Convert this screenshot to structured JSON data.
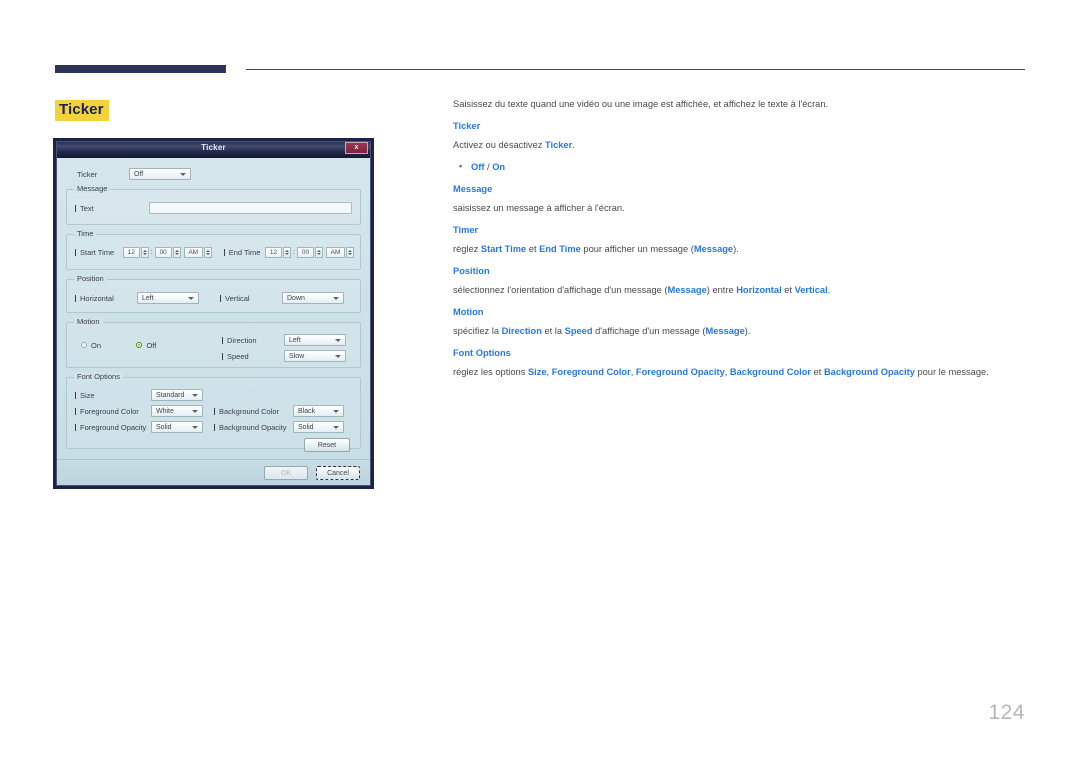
{
  "page": {
    "section_title": "Ticker",
    "page_number": "124",
    "accent_link": "#2878e0",
    "highlight": "#f4d23c",
    "rule_color": "#2e3358"
  },
  "dialog": {
    "title": "Ticker",
    "close_label": "x",
    "ticker": {
      "label": "Ticker",
      "value": "Off"
    },
    "message": {
      "legend": "Message",
      "text_label": "Text",
      "text_value": ""
    },
    "time": {
      "legend": "Time",
      "start_label": "Start Time",
      "start_hour": "12",
      "start_minute": "00",
      "start_meridiem": "AM",
      "end_label": "End Time",
      "end_hour": "12",
      "end_minute": "00",
      "end_meridiem": "AM",
      "colon": ":"
    },
    "position": {
      "legend": "Position",
      "horizontal_label": "Horizontal",
      "horizontal_value": "Left",
      "vertical_label": "Vertical",
      "vertical_value": "Down"
    },
    "motion": {
      "legend": "Motion",
      "on_label": "On",
      "off_label": "Off",
      "selected": "Off",
      "direction_label": "Direction",
      "direction_value": "Left",
      "speed_label": "Speed",
      "speed_value": "Slow"
    },
    "font_options": {
      "legend": "Font Options",
      "size_label": "Size",
      "size_value": "Standard",
      "foreground_color_label": "Foreground Color",
      "foreground_color_value": "White",
      "background_color_label": "Background Color",
      "background_color_value": "Black",
      "foreground_opacity_label": "Foreground Opacity",
      "foreground_opacity_value": "Solid",
      "background_opacity_label": "Background Opacity",
      "background_opacity_value": "Solid",
      "reset_label": "Reset"
    },
    "footer": {
      "ok_label": "OK",
      "cancel_label": "Cancel"
    }
  },
  "doc": {
    "intro": "Saisissez du texte quand une vidéo ou une image est affichée, et affichez le texte à l'écran.",
    "ticker_heading": "Ticker",
    "ticker_line_pre": "Activez ou désactivez ",
    "ticker_line_key": "Ticker",
    "ticker_line_post": ".",
    "bullet_off": "Off",
    "bullet_sep": " / ",
    "bullet_on": "On",
    "message_heading": "Message",
    "message_line": "saisissez un message à afficher à l'écran.",
    "timer_heading": "Timer",
    "timer_line_a": "réglez ",
    "timer_key_start": "Start Time",
    "timer_line_b": " et ",
    "timer_key_end": "End Time",
    "timer_line_c": " pour afficher un message (",
    "timer_key_msg": "Message",
    "timer_line_d": ").",
    "position_heading": "Position",
    "position_line_a": "sélectionnez l'orientation d'affichage d'un message (",
    "position_key_msg": "Message",
    "position_line_b": ") entre ",
    "position_key_h": "Horizontal",
    "position_line_c": " et ",
    "position_key_v": "Vertical",
    "position_line_d": ".",
    "motion_heading": "Motion",
    "motion_line_a": "spécifiez la ",
    "motion_key_dir": "Direction",
    "motion_line_b": " et la ",
    "motion_key_speed": "Speed",
    "motion_line_c": " d'affichage d'un message (",
    "motion_key_msg": "Message",
    "motion_line_d": ").",
    "font_heading": "Font Options",
    "font_line_a": "réglez les options ",
    "font_key_size": "Size",
    "font_sep1": ", ",
    "font_key_fgc": "Foreground Color",
    "font_sep2": ", ",
    "font_key_fgo": "Foreground Opacity",
    "font_sep3": ", ",
    "font_key_bgc": "Background Color",
    "font_sep4": " et ",
    "font_key_bgo": "Background Opacity",
    "font_line_b": " pour le message."
  }
}
